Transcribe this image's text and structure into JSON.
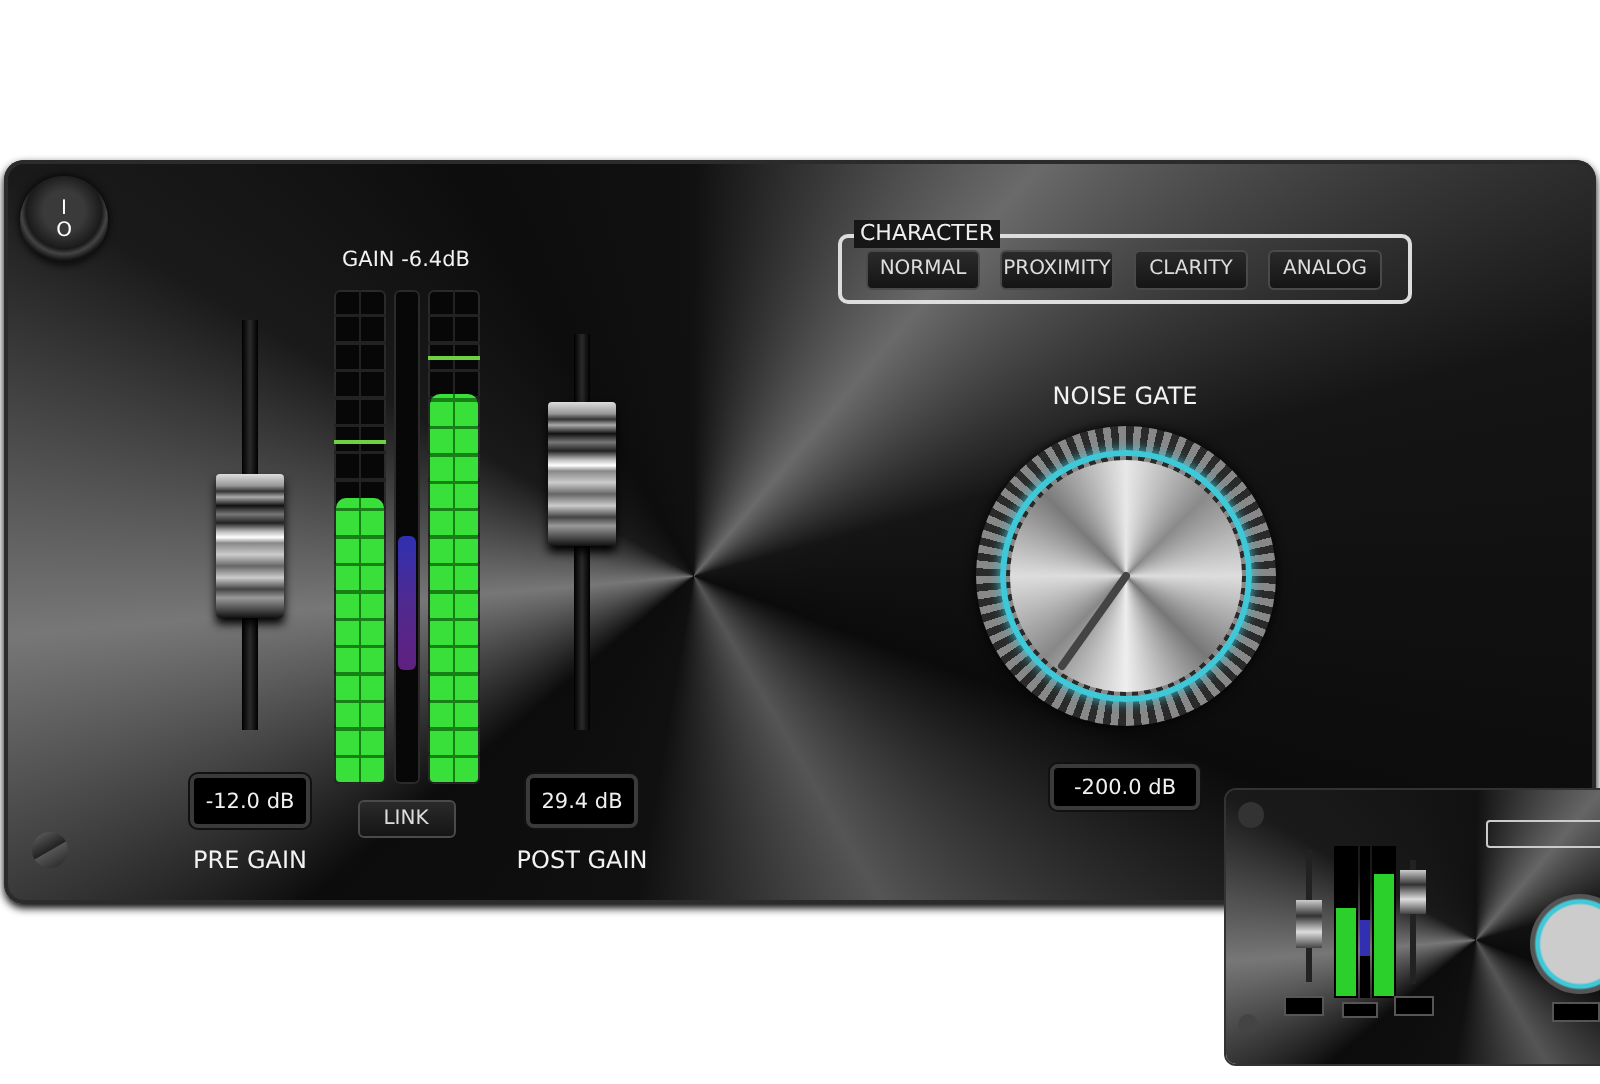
{
  "power_switch": {
    "top": "I",
    "bottom": "O",
    "on": true
  },
  "gain_readout": "GAIN -6.4dB",
  "pre_gain": {
    "label": "PRE GAIN",
    "value": "-12.0 dB",
    "level": 0.42
  },
  "post_gain": {
    "label": "POST GAIN",
    "value": "29.4 dB",
    "level": 0.73
  },
  "meters": [
    {
      "kind": "signal",
      "level": 0.58,
      "peak_hold": {
        "level": 0.69
      }
    },
    {
      "kind": "reduction",
      "level": 0.27
    },
    {
      "kind": "signal",
      "level": 0.79,
      "peak_hold": {
        "level": 0.86
      }
    }
  ],
  "link_button": "LINK",
  "character": {
    "title": "CHARACTER",
    "options": [
      {
        "label": "NORMAL",
        "selected": false
      },
      {
        "label": "PROXIMITY",
        "selected": false
      },
      {
        "label": "CLARITY",
        "selected": false
      },
      {
        "label": "ANALOG",
        "selected": false
      }
    ]
  },
  "noise_gate": {
    "label": "NOISE GATE",
    "value": "-200.0 dB"
  }
}
